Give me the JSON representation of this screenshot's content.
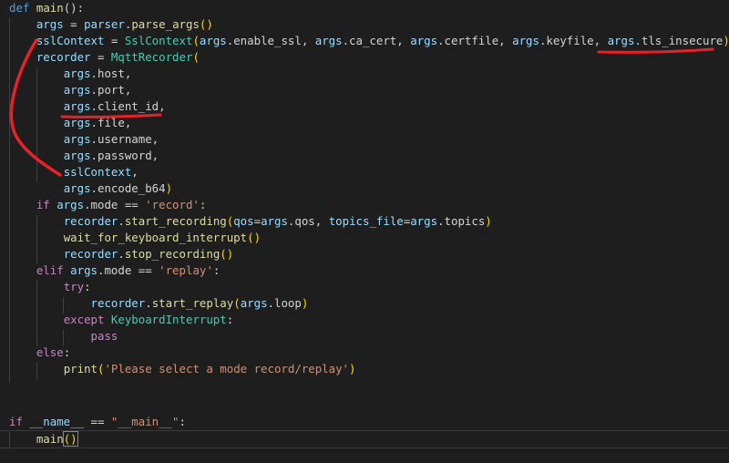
{
  "code": {
    "l1": {
      "kw": "def",
      "fn": "main",
      "rest": "():"
    },
    "l2": {
      "v": "args",
      "eq": " = ",
      "obj": "parser",
      "dot": ".",
      "fn": "parse_args",
      "rest": "()"
    },
    "l3": {
      "v": "sslContext",
      "eq": " = ",
      "cls": "SslContext",
      "open": "(",
      "a1": "args",
      "a1b": ".enable_ssl, ",
      "a2": "args",
      "a2b": ".ca_cert, ",
      "a3": "args",
      "a3b": ".certfile, ",
      "a4": "args",
      "a4b": ".keyfile, ",
      "a5": "args",
      "a5b": ".tls_insecure",
      "close": ")"
    },
    "l4": {
      "v": "recorder",
      "eq": " = ",
      "cls": "MqttRecorder",
      "open": "("
    },
    "l5": {
      "a": "args",
      "b": ".host,"
    },
    "l6": {
      "a": "args",
      "b": ".port,"
    },
    "l7": {
      "a": "args",
      "b": ".client_id,"
    },
    "l8": {
      "a": "args",
      "b": ".file,"
    },
    "l9": {
      "a": "args",
      "b": ".username,"
    },
    "l10": {
      "a": "args",
      "b": ".password,"
    },
    "l11": {
      "a": "sslContext",
      "b": ","
    },
    "l12": {
      "a": "args",
      "b": ".encode_b64",
      "close": ")"
    },
    "l13": {
      "kw": "if",
      "v": " args",
      "rest": ".mode == ",
      "str": "'record'",
      "end": ":"
    },
    "l14": {
      "v": "recorder",
      "dot": ".",
      "fn": "start_recording",
      "open": "(",
      "p1": "qos",
      "p1b": "=",
      "p2": "args",
      "p2b": ".qos, ",
      "p3": "topics_file",
      "p3b": "=",
      "p4": "args",
      "p4b": ".topics",
      "close": ")"
    },
    "l15": {
      "fn": "wait_for_keyboard_interrupt",
      "rest": "()"
    },
    "l16": {
      "v": "recorder",
      "dot": ".",
      "fn": "stop_recording",
      "rest": "()"
    },
    "l17": {
      "kw": "elif",
      "v": " args",
      "rest": ".mode == ",
      "str": "'replay'",
      "end": ":"
    },
    "l18": {
      "kw": "try",
      "end": ":"
    },
    "l19": {
      "v": "recorder",
      "dot": ".",
      "fn": "start_replay",
      "open": "(",
      "a": "args",
      "b": ".loop",
      "close": ")"
    },
    "l20": {
      "kw": "except",
      "cls": " KeyboardInterrupt",
      "end": ":"
    },
    "l21": {
      "kw": "pass"
    },
    "l22": {
      "kw": "else",
      "end": ":"
    },
    "l23": {
      "fn": "print",
      "open": "(",
      "str": "'Please select a mode record/replay'",
      "close": ")"
    },
    "l25": {
      "kw": "if",
      "v": " __name__",
      "rest": " == ",
      "str": "\"__main__\"",
      "end": ":"
    },
    "l26": {
      "fn": "main",
      "open": "(",
      "close": ")"
    }
  },
  "colors": {
    "background": "#1e1e1e",
    "keyword": "#569cd6",
    "control": "#c586c0",
    "function": "#dcdcaa",
    "variable": "#9cdcfe",
    "class": "#4ec9b0",
    "string": "#ce9178",
    "annotation_marker": "#e8202a"
  }
}
